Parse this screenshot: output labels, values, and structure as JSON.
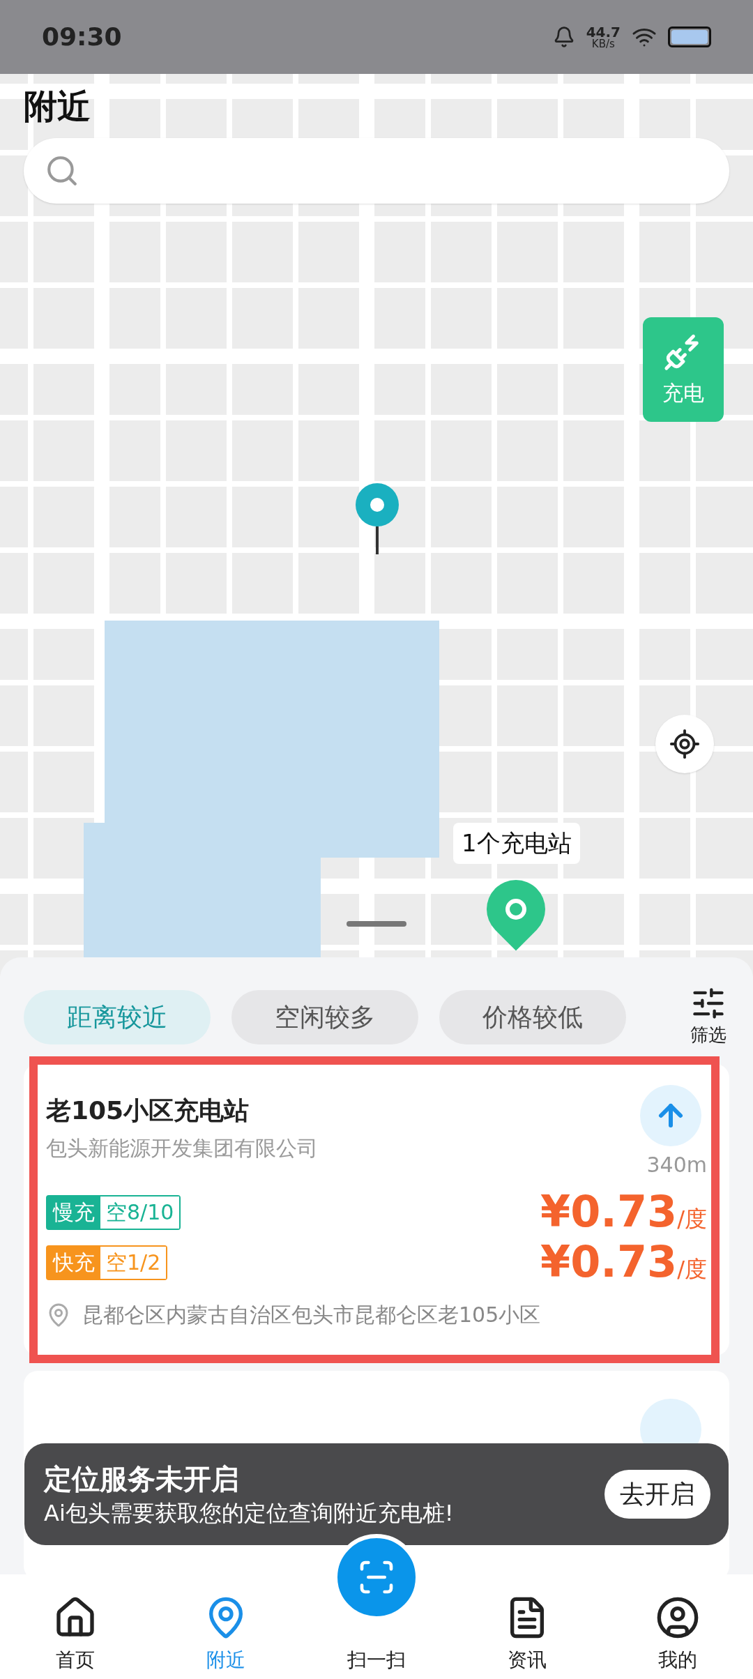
{
  "status_bar": {
    "time": "09:30",
    "speed_value": "44.7",
    "speed_unit": "KB/s"
  },
  "header": {
    "title": "附近"
  },
  "map": {
    "charge_button": "充电",
    "station_bubble": "1个充电站"
  },
  "sort_tabs": [
    {
      "label": "距离较近",
      "selected": true
    },
    {
      "label": "空闲较多",
      "selected": false
    },
    {
      "label": "价格较低",
      "selected": false
    }
  ],
  "filter": {
    "label": "筛选"
  },
  "stations": [
    {
      "name": "老105小区充电站",
      "company": "包头新能源开发集团有限公司",
      "distance": "340m",
      "address": "昆都仑区内蒙古自治区包头市昆都仑区老105小区",
      "chargers": [
        {
          "kind": "slow",
          "type": "慢充",
          "free": "空8/10",
          "price": "¥0.73",
          "unit": "/度"
        },
        {
          "kind": "fast",
          "type": "快充",
          "free": "空1/2",
          "price": "¥0.73",
          "unit": "/度"
        }
      ]
    }
  ],
  "toast": {
    "title": "定位服务未开启",
    "message": "Ai包头需要获取您的定位查询附近充电桩!",
    "button": "去开启"
  },
  "nav": [
    {
      "label": "首页",
      "selected": false
    },
    {
      "label": "附近",
      "selected": true
    },
    {
      "label": "扫一扫",
      "selected": false
    },
    {
      "label": "资讯",
      "selected": false
    },
    {
      "label": "我的",
      "selected": false
    }
  ]
}
